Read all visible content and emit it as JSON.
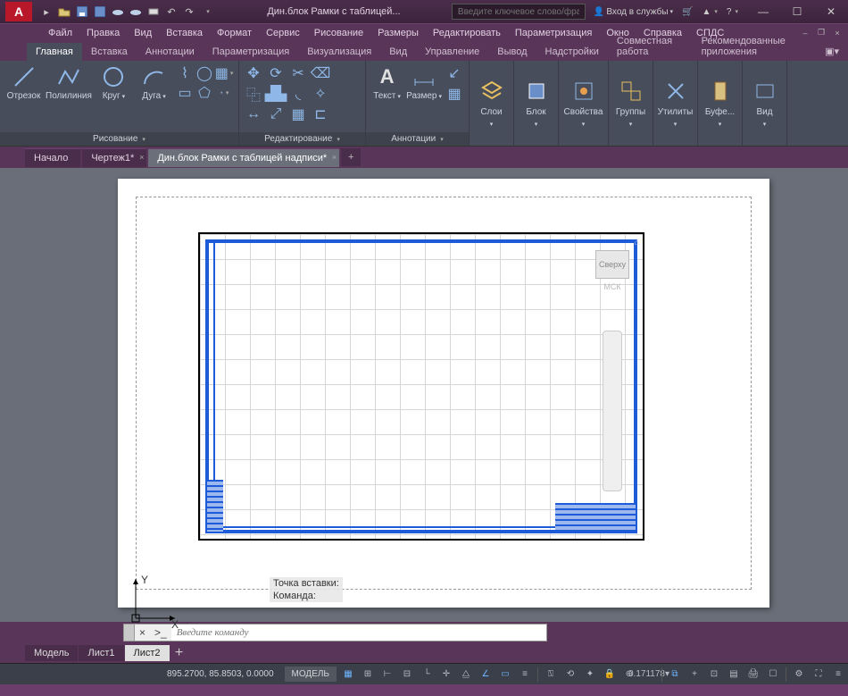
{
  "title": "Дин.блок Рамки с таблицей...",
  "search_placeholder": "Введите ключевое слово/фразу",
  "signin": "Вход в службы",
  "menu": [
    "Файл",
    "Правка",
    "Вид",
    "Вставка",
    "Формат",
    "Сервис",
    "Рисование",
    "Размеры",
    "Редактировать",
    "Параметризация",
    "Окно",
    "Справка",
    "СПДС"
  ],
  "ribbon_tabs": [
    "Главная",
    "Вставка",
    "Аннотации",
    "Параметризация",
    "Визуализация",
    "Вид",
    "Управление",
    "Вывод",
    "Надстройки",
    "Совместная работа",
    "Рекомендованные приложения"
  ],
  "panels": {
    "draw": {
      "title": "Рисование",
      "btns": {
        "line": "Отрезок",
        "pline": "Полилиния",
        "circle": "Круг",
        "arc": "Дуга"
      }
    },
    "modify": {
      "title": "Редактирование"
    },
    "annot": {
      "title": "Аннотации",
      "btns": {
        "text": "Текст",
        "dim": "Размер"
      }
    },
    "layers": "Слои",
    "block": "Блок",
    "props": "Свойства",
    "groups": "Группы",
    "utils": "Утилиты",
    "clip": "Буфе...",
    "view": "Вид"
  },
  "doc_tabs": [
    {
      "label": "Начало",
      "active": false
    },
    {
      "label": "Чертеж1*",
      "active": false
    },
    {
      "label": "Дин.блок Рамки с таблицей надписи*",
      "active": true
    }
  ],
  "viewcube": {
    "face": "Сверху",
    "wcs": "МСК"
  },
  "cmd_hist": [
    "Точка вставки:",
    "Команда:"
  ],
  "cmd_placeholder": "Введите команду",
  "layout_tabs": [
    {
      "l": "Модель",
      "a": false
    },
    {
      "l": "Лист1",
      "a": false
    },
    {
      "l": "Лист2",
      "a": true
    }
  ],
  "status": {
    "coords": "895.2700, 85.8503, 0.0000",
    "mode": "МОДЕЛЬ",
    "scale": "0.171178"
  }
}
